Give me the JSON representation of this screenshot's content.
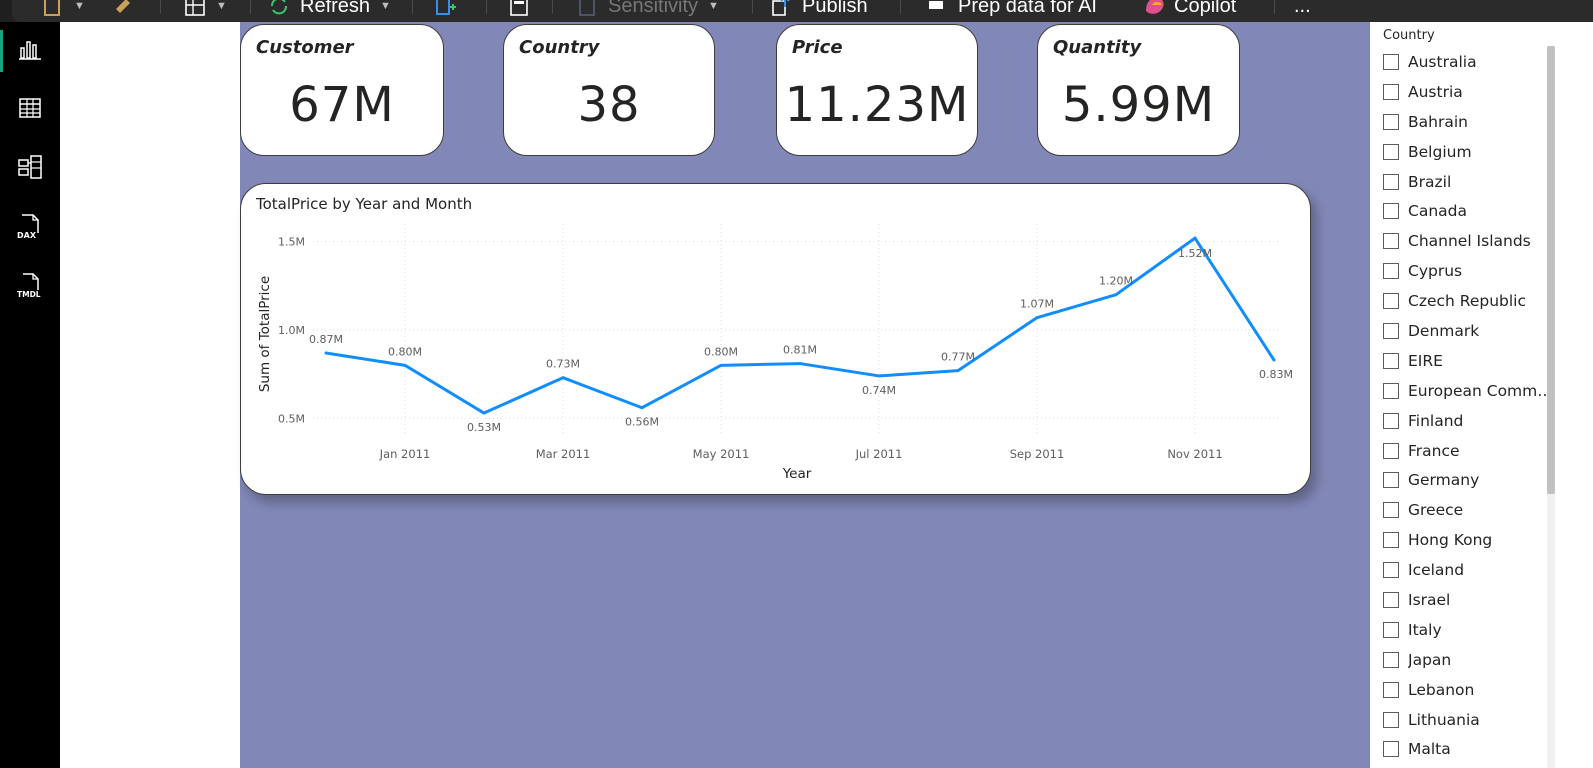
{
  "ribbon": {
    "refresh_label": "Refresh",
    "sensitivity_label": "Sensitivity",
    "publish_label": "Publish",
    "prep_data_label": "Prep data for AI",
    "copilot_label": "Copilot",
    "more_label": "..."
  },
  "rail": {
    "items": [
      {
        "name": "report-view",
        "icon": "bar-chart-icon",
        "active": true
      },
      {
        "name": "table-view",
        "icon": "table-icon",
        "active": false
      },
      {
        "name": "model-view",
        "icon": "model-icon",
        "active": false
      },
      {
        "name": "dax-query-view",
        "icon": "dax-icon",
        "label": "DAX",
        "active": false
      },
      {
        "name": "tmdl-view",
        "icon": "tmdl-icon",
        "label": "TMDL",
        "active": false
      }
    ]
  },
  "cards": [
    {
      "title": "Customer",
      "value": "67M"
    },
    {
      "title": "Country",
      "value": "38"
    },
    {
      "title": "Price",
      "value": "11.23M"
    },
    {
      "title": "Quantity",
      "value": "5.99M"
    }
  ],
  "chart_data": {
    "type": "line",
    "title": "TotalPrice by Year and Month",
    "xlabel": "Year",
    "ylabel": "Sum of TotalPrice",
    "x_tick_labels": [
      "Jan 2011",
      "Mar 2011",
      "May 2011",
      "Jul 2011",
      "Sep 2011",
      "Nov 2011"
    ],
    "y_tick_labels": [
      "1.5M",
      "1.0M",
      "0.5M"
    ],
    "y_ticks": [
      1.5,
      1.0,
      0.5
    ],
    "ylim": [
      0.4,
      1.6
    ],
    "x": [
      "Dec 2010",
      "Jan 2011",
      "Feb 2011",
      "Mar 2011",
      "Apr 2011",
      "May 2011",
      "Jun 2011",
      "Jul 2011",
      "Aug 2011",
      "Sep 2011",
      "Oct 2011",
      "Nov 2011",
      "Dec 2011"
    ],
    "values": [
      0.87,
      0.8,
      0.53,
      0.73,
      0.56,
      0.8,
      0.81,
      0.74,
      0.77,
      1.07,
      1.2,
      1.52,
      0.83
    ],
    "data_labels": [
      "0.87M",
      "0.80M",
      "0.53M",
      "0.73M",
      "0.56M",
      "0.80M",
      "0.81M",
      "0.74M",
      "0.77M",
      "1.07M",
      "1.20M",
      "1.52M",
      "0.83M"
    ],
    "grid": true,
    "line_color": "#118dff"
  },
  "slicer": {
    "header": "Country",
    "items": [
      "Australia",
      "Austria",
      "Bahrain",
      "Belgium",
      "Brazil",
      "Canada",
      "Channel Islands",
      "Cyprus",
      "Czech Republic",
      "Denmark",
      "EIRE",
      "European Commu...",
      "Finland",
      "France",
      "Germany",
      "Greece",
      "Hong Kong",
      "Iceland",
      "Israel",
      "Italy",
      "Japan",
      "Lebanon",
      "Lithuania",
      "Malta"
    ]
  },
  "colors": {
    "page_background": "#8187b6",
    "rail_background": "#000000",
    "rail_active": "#1aa383",
    "line": "#118dff"
  }
}
